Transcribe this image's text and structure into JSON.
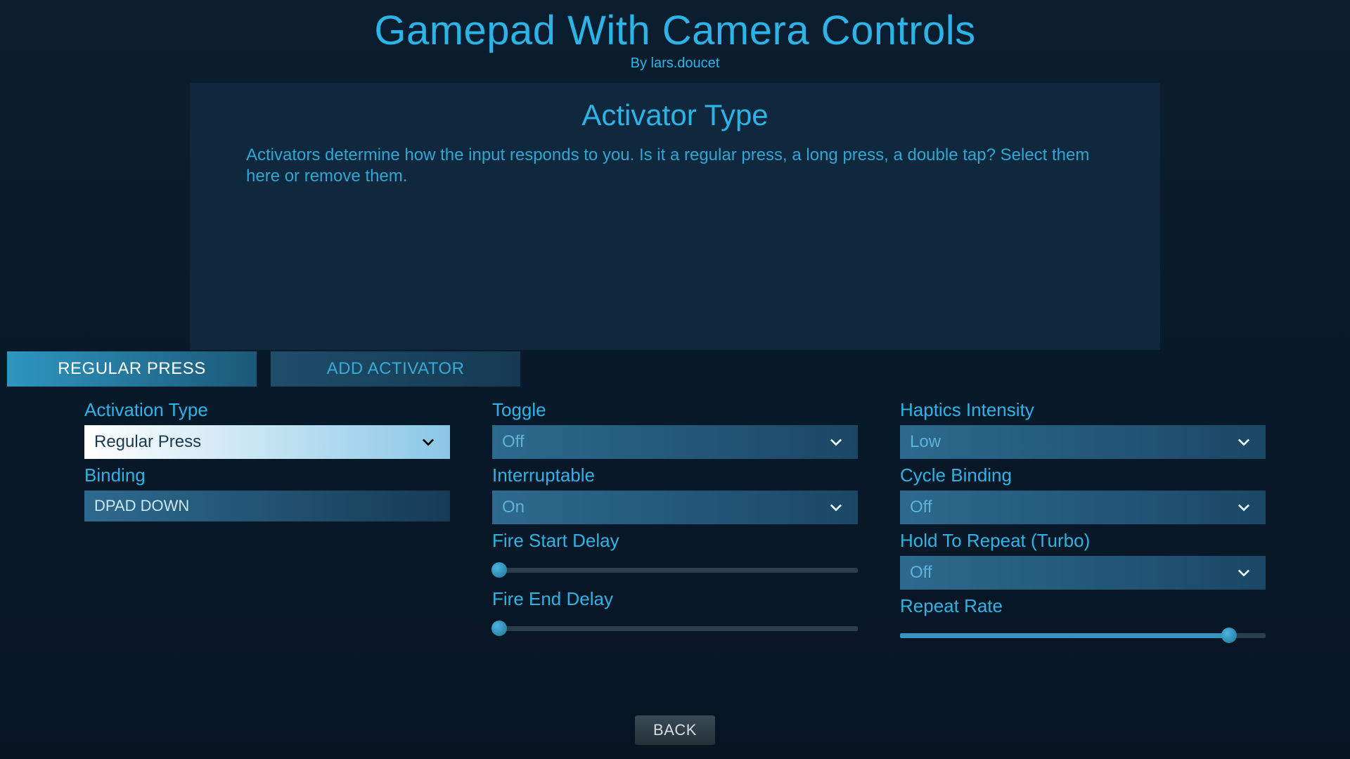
{
  "header": {
    "title": "Gamepad With Camera Controls",
    "byline": "By lars.doucet"
  },
  "info": {
    "heading": "Activator Type",
    "description": "Activators determine how the input responds to you.  Is it a regular press, a long press, a double tap?  Select them here or remove them."
  },
  "tabs": {
    "active": "REGULAR PRESS",
    "add": "ADD ACTIVATOR"
  },
  "col1": {
    "activation_type_label": "Activation Type",
    "activation_type_value": "Regular Press",
    "binding_label": "Binding",
    "binding_value": "DPAD DOWN"
  },
  "col2": {
    "toggle_label": "Toggle",
    "toggle_value": "Off",
    "interruptable_label": "Interruptable",
    "interruptable_value": "On",
    "fire_start_label": "Fire Start Delay",
    "fire_start_value": 0,
    "fire_end_label": "Fire End Delay",
    "fire_end_value": 0
  },
  "col3": {
    "haptics_label": "Haptics Intensity",
    "haptics_value": "Low",
    "cycle_label": "Cycle Binding",
    "cycle_value": "Off",
    "turbo_label": "Hold To Repeat (Turbo)",
    "turbo_value": "Off",
    "repeat_label": "Repeat Rate",
    "repeat_value": 90
  },
  "footer": {
    "back": "BACK"
  }
}
